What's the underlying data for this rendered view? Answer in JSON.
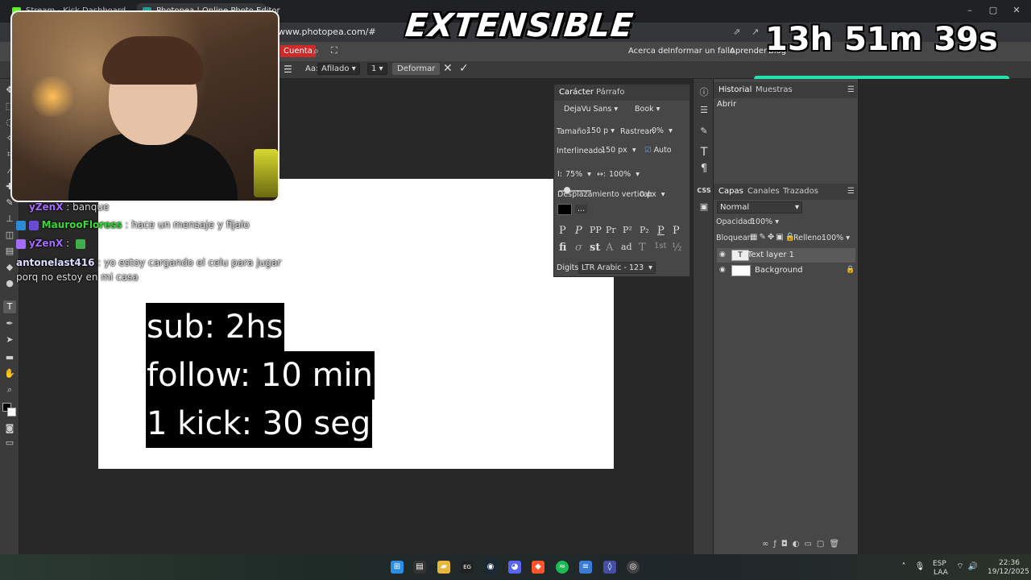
{
  "browser": {
    "tabs": [
      {
        "label": "Stream - Kick Dashboard",
        "active": false
      },
      {
        "label": "Photopea | Online Photo Editor",
        "active": true
      }
    ],
    "url": "www.photopea.com/#",
    "window_controls": [
      "minimize-icon",
      "maximize-icon",
      "close-icon"
    ]
  },
  "menubar": {
    "cuenta": "Cuenta",
    "links": [
      "Acerca de",
      "Informar un fallo",
      "Aprender",
      "Blog"
    ]
  },
  "options_bar": {
    "aa_label": "Aa:",
    "antialias": "Afilado",
    "value_1": "1",
    "deformar": "Deformar"
  },
  "overlay": {
    "title": "EXTENSIBLE",
    "timer": "13h 51m 39s",
    "progress_fraction": 0.998
  },
  "chat": [
    {
      "user": "yZenX",
      "text": "banque",
      "user_color": "#a36cff"
    },
    {
      "user": "MaurooFloress",
      "text": "hace un mensaje y fijalo",
      "user_color": "#33dd33"
    },
    {
      "user": "yZenX",
      "text": "",
      "user_color": "#a36cff"
    },
    {
      "user": "antonelast416",
      "text": "yo estoy cargando el celu para jugar",
      "user_color": "#ddddff"
    },
    {
      "user": "",
      "text": "porq no estoy en mi casa",
      "user_color": "#ffffff"
    }
  ],
  "canvas": {
    "lines": [
      "sub: 2hs",
      "follow: 10 min",
      "1 kick: 30 seg"
    ]
  },
  "character_panel": {
    "tabs": [
      "Carácter",
      "Párrafo"
    ],
    "font": "DejaVu Sans",
    "style": "Book",
    "size_label": "Tamaño:",
    "size_value": "150 p",
    "tracking_label": "Rastrear:",
    "tracking_value": "0%",
    "leading_label": "Interlineado:",
    "leading_value": "150 px",
    "auto_label": "Auto",
    "vscale_label": "I:",
    "vscale_value": "75%",
    "hscale_label": "↔:",
    "hscale_value": "100%",
    "baseline_label": "Desplazamiento vertical:",
    "baseline_value": "0 px",
    "more": "...",
    "glyph_row1": [
      "P",
      "P",
      "PP",
      "Pr",
      "P²",
      "P₂",
      "P",
      "P"
    ],
    "glyph_row2": [
      "fi",
      "σ",
      "st",
      "A",
      "ad",
      "T",
      "1st",
      "½"
    ],
    "digits_label": "Digits:",
    "digits_value": "LTR Arabic - 123"
  },
  "history_panel": {
    "tabs": [
      "Historial",
      "Muestras"
    ],
    "items": [
      "Abrir"
    ]
  },
  "layers_panel": {
    "tabs": [
      "Capas",
      "Canales",
      "Trazados"
    ],
    "blend_mode": "Normal",
    "opacity_label": "Opacidad:",
    "opacity_value": "100%",
    "lock_label": "Bloquear:",
    "fill_label": "Relleno:",
    "fill_value": "100%",
    "layers": [
      {
        "name": "Text layer 1",
        "selected": true
      },
      {
        "name": "Background",
        "selected": false
      }
    ]
  },
  "taskbar": {
    "lang": "ESP",
    "lang2": "LAA",
    "time": "22:36",
    "date": "19/12/2025"
  }
}
